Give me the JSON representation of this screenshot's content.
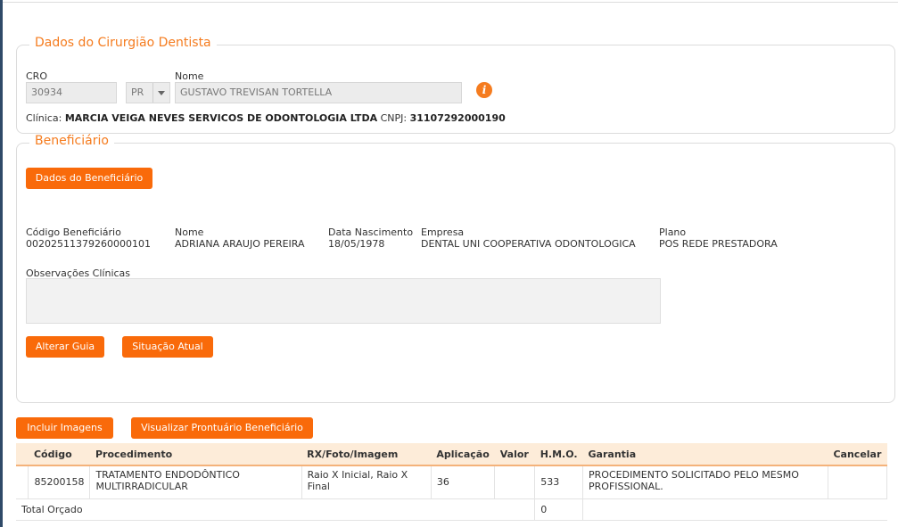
{
  "dentist": {
    "legend": "Dados do Cirurgião Dentista",
    "cro_label": "CRO",
    "cro_value": "30934",
    "uf_value": "PR",
    "nome_label": "Nome",
    "nome_value": "GUSTAVO TREVISAN TORTELLA",
    "clinica_label": "Clínica:",
    "clinica_value": "MARCIA VEIGA NEVES SERVICOS DE ODONTOLOGIA LTDA",
    "cnpj_label": "CNPJ:",
    "cnpj_value": "31107292000190",
    "info_glyph": "i"
  },
  "beneficiary": {
    "legend": "Beneficiário",
    "dados_button": "Dados do Beneficiário",
    "fields": [
      {
        "label": "Código Beneficiário",
        "value": "00202511379260000101"
      },
      {
        "label": "Nome",
        "value": "ADRIANA ARAUJO PEREIRA"
      },
      {
        "label": "Data Nascimento",
        "value": "18/05/1978"
      },
      {
        "label": "Empresa",
        "value": "DENTAL UNI COOPERATIVA ODONTOLOGICA"
      },
      {
        "label": "Plano",
        "value": "POS REDE PRESTADORA"
      }
    ],
    "observacoes_label": "Observações Clínicas",
    "alterar_button": "Alterar Guia",
    "situacao_button": "Situação Atual"
  },
  "actions": {
    "incluir_imagens": "Incluir Imagens",
    "visualizar_prontuario": "Visualizar Prontuário Beneficiário"
  },
  "table": {
    "headers": [
      "Código",
      "Procedimento",
      "RX/Foto/Imagem",
      "Aplicação",
      "Valor",
      "H.M.O.",
      "Garantia",
      "Cancelar"
    ],
    "rows": [
      {
        "codigo": "85200158",
        "procedimento": "TRATAMENTO ENDODÔNTICO MULTIRRADICULAR",
        "rx": "Raio X Inicial, Raio X Final",
        "aplicacao": "36",
        "valor": "",
        "hmo": "533",
        "garantia": "PROCEDIMENTO SOLICITADO PELO MESMO PROFISSIONAL.",
        "cancelar": ""
      }
    ],
    "total_label": "Total Orçado",
    "total_hmo": "0"
  },
  "icons": {
    "info": "info-icon",
    "dropdown": "chevron-down-icon"
  },
  "colors": {
    "accent": "#f96a0a",
    "legend": "#f57c1f",
    "table_header_bg": "#fdecd9"
  }
}
